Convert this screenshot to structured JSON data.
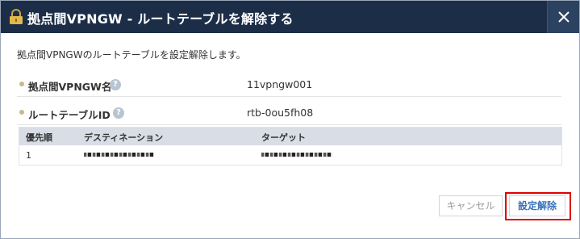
{
  "dialog": {
    "title": "拠点間VPNGW - ルートテーブルを解除する",
    "description": "拠点間VPNGWのルートテーブルを設定解除します。"
  },
  "fields": [
    {
      "label": "拠点間VPNGW名",
      "value": "11vpngw001"
    },
    {
      "label": "ルートテーブルID",
      "value": "rtb-0ou5fh08"
    }
  ],
  "help_icon_glyph": "?",
  "table": {
    "headers": [
      "優先順",
      "デスティネーション",
      "ターゲット"
    ],
    "rows": [
      {
        "priority": "1",
        "destination": "redacted",
        "target": "redacted"
      }
    ]
  },
  "buttons": {
    "cancel": "キャンセル",
    "confirm": "設定解除"
  },
  "colors": {
    "titlebar": "#1c2e47",
    "confirm_text": "#3a73b8",
    "highlight": "#e00000"
  },
  "icons": {
    "title": "lock-icon",
    "close": "close-icon",
    "help": "help-icon"
  }
}
